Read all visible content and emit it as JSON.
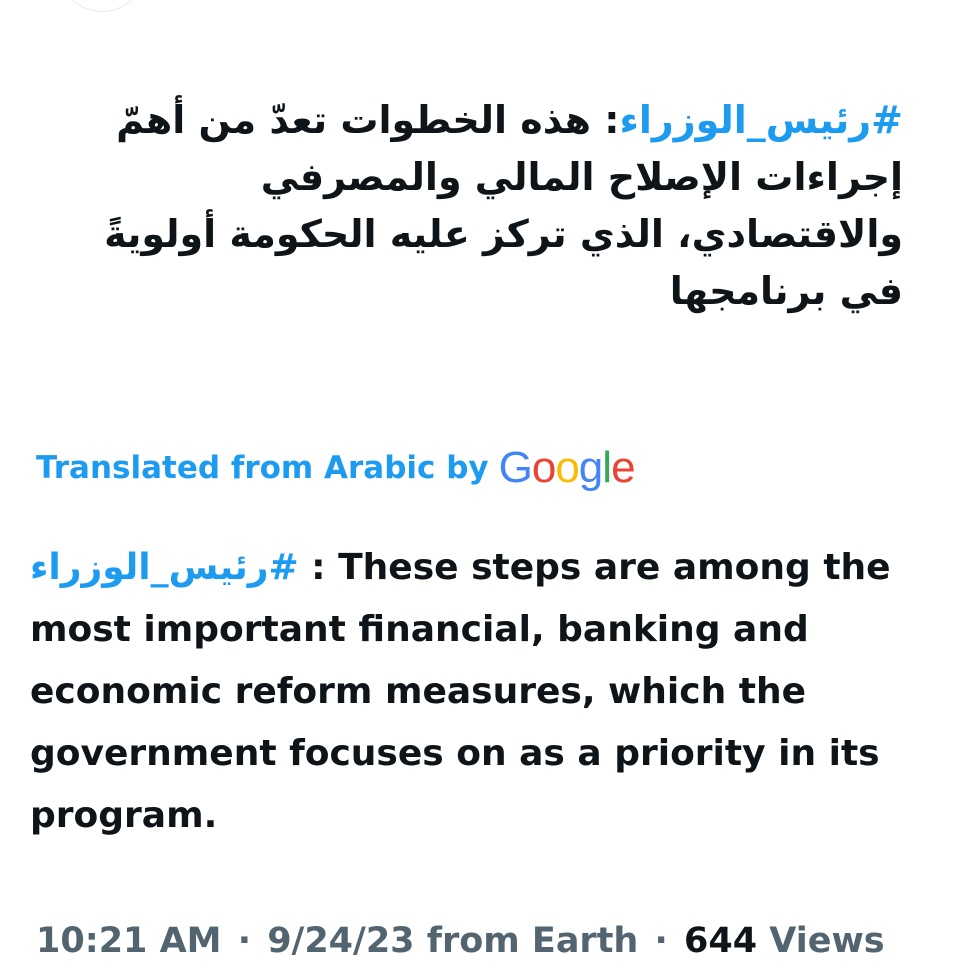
{
  "tweet": {
    "original": {
      "hashtag": "#رئيس_الوزراء",
      "text": ": هذه الخطوات تعدّ من أهمّ إجراءات الإصلاح المالي والمصرفي والاقتصادي، الذي تركز عليه الحكومة أولويةً في برنامجها"
    },
    "translation": {
      "label": "Translated from Arabic by",
      "provider_letters": [
        {
          "ch": "G",
          "color": "#4285f4"
        },
        {
          "ch": "o",
          "color": "#ea4335"
        },
        {
          "ch": "o",
          "color": "#fbbc05"
        },
        {
          "ch": "g",
          "color": "#4285f4"
        },
        {
          "ch": "l",
          "color": "#34a853"
        },
        {
          "ch": "e",
          "color": "#ea4335"
        }
      ],
      "hashtag": "#رئيس_الوزراء",
      "text": " : These steps are among the most important financial, banking and economic reform measures, which the government focuses on as a priority in its program."
    },
    "meta": {
      "time": "10:21 AM",
      "separator": "·",
      "date": "9/24/23",
      "source": "from Earth",
      "views_count": "644",
      "views_label": "Views"
    }
  },
  "colors": {
    "accent": "#1d9bf0",
    "text": "#0f1419",
    "secondary": "#536471"
  }
}
